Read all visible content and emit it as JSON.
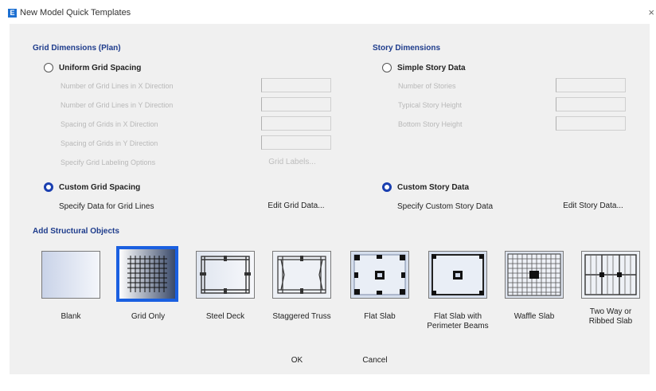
{
  "window": {
    "app_icon_letter": "E",
    "title": "New Model Quick Templates",
    "close_glyph": "×"
  },
  "grid": {
    "heading": "Grid Dimensions (Plan)",
    "uniform": {
      "label": "Uniform Grid Spacing",
      "checked": false,
      "fields": [
        {
          "label": "Number of Grid Lines in X Direction",
          "value": ""
        },
        {
          "label": "Number of Grid Lines in Y Direction",
          "value": ""
        },
        {
          "label": "Spacing of Grids in X Direction",
          "value": ""
        },
        {
          "label": "Spacing of Grids in Y Direction",
          "value": ""
        }
      ],
      "labeling_label": "Specify Grid Labeling Options",
      "labeling_button": "Grid Labels..."
    },
    "custom": {
      "label": "Custom Grid Spacing",
      "checked": true,
      "spec_label": "Specify Data for Grid Lines",
      "edit_button": "Edit Grid Data..."
    }
  },
  "story": {
    "heading": "Story Dimensions",
    "simple": {
      "label": "Simple Story Data",
      "checked": false,
      "fields": [
        {
          "label": "Number of Stories",
          "value": ""
        },
        {
          "label": "Typical Story Height",
          "value": ""
        },
        {
          "label": "Bottom Story Height",
          "value": ""
        }
      ]
    },
    "custom": {
      "label": "Custom Story Data",
      "checked": true,
      "spec_label": "Specify Custom Story Data",
      "edit_button": "Edit Story Data..."
    }
  },
  "objects": {
    "heading": "Add Structural Objects",
    "templates": [
      {
        "label": "Blank",
        "icon": "blank-template-icon",
        "selected": false
      },
      {
        "label": "Grid Only",
        "icon": "grid-only-template-icon",
        "selected": true
      },
      {
        "label": "Steel Deck",
        "icon": "steel-deck-template-icon",
        "selected": false
      },
      {
        "label": "Staggered Truss",
        "icon": "staggered-truss-template-icon",
        "selected": false
      },
      {
        "label": "Flat Slab",
        "icon": "flat-slab-template-icon",
        "selected": false
      },
      {
        "label": "Flat Slab with\nPerimeter Beams",
        "icon": "flat-slab-perimeter-beams-template-icon",
        "selected": false
      },
      {
        "label": "Waffle Slab",
        "icon": "waffle-slab-template-icon",
        "selected": false
      },
      {
        "label": "Two Way or\nRibbed Slab",
        "icon": "two-way-ribbed-slab-template-icon",
        "selected": false
      }
    ]
  },
  "footer": {
    "ok": "OK",
    "cancel": "Cancel"
  },
  "colors": {
    "accent": "#1a5fe0",
    "heading": "#1e3c8c",
    "panel": "#f0f0f0"
  }
}
